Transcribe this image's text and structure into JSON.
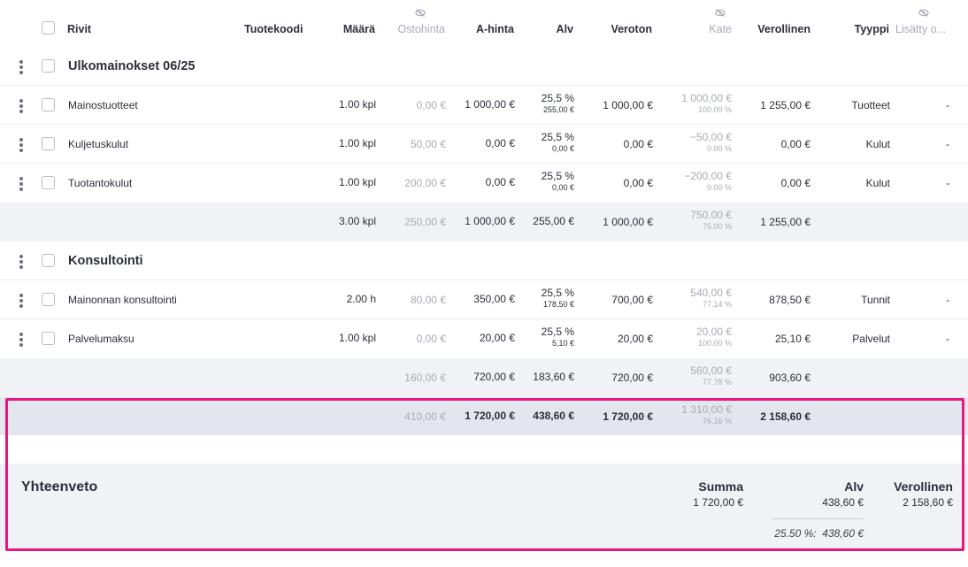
{
  "columns": {
    "rows": "Rivit",
    "product_code": "Tuotekoodi",
    "quantity": "Määrä",
    "purchase_price": "Ostohinta",
    "unit_price": "A-hinta",
    "vat": "Alv",
    "net": "Veroton",
    "margin": "Kate",
    "gross": "Verollinen",
    "type": "Tyyppi",
    "added": "Lisätty o..."
  },
  "groups": [
    {
      "name": "Ulkomainokset 06/25",
      "items": [
        {
          "name": "Mainostuotteet",
          "qty": "1.00 kpl",
          "purchase": "0,00 €",
          "unit": "1 000,00 €",
          "vat_pct": "25,5 %",
          "vat_amt": "255,00 €",
          "net": "1 000,00 €",
          "margin": "1 000,00 €",
          "margin_pct": "100.00 %",
          "gross": "1 255,00 €",
          "type": "Tuotteet",
          "added": "-"
        },
        {
          "name": "Kuljetuskulut",
          "qty": "1.00 kpl",
          "purchase": "50,00 €",
          "unit": "0,00 €",
          "vat_pct": "25,5 %",
          "vat_amt": "0,00 €",
          "net": "0,00 €",
          "margin": "−50,00 €",
          "margin_pct": "0.00 %",
          "gross": "0,00 €",
          "type": "Kulut",
          "added": "-"
        },
        {
          "name": "Tuotantokulut",
          "qty": "1.00 kpl",
          "purchase": "200,00 €",
          "unit": "0,00 €",
          "vat_pct": "25,5 %",
          "vat_amt": "0,00 €",
          "net": "0,00 €",
          "margin": "−200,00 €",
          "margin_pct": "0.00 %",
          "gross": "0,00 €",
          "type": "Kulut",
          "added": "-"
        }
      ],
      "subtotal": {
        "qty": "3.00 kpl",
        "purchase": "250,00 €",
        "unit": "1 000,00 €",
        "vat": "255,00 €",
        "net": "1 000,00 €",
        "margin": "750,00 €",
        "margin_pct": "75.00 %",
        "gross": "1 255,00 €"
      }
    },
    {
      "name": "Konsultointi",
      "items": [
        {
          "name": "Mainonnan konsultointi",
          "qty": "2.00 h",
          "purchase": "80,00 €",
          "unit": "350,00 €",
          "vat_pct": "25,5 %",
          "vat_amt": "178,50 €",
          "net": "700,00 €",
          "margin": "540,00 €",
          "margin_pct": "77.14 %",
          "gross": "878,50 €",
          "type": "Tunnit",
          "added": "-"
        },
        {
          "name": "Palvelumaksu",
          "qty": "1.00 kpl",
          "purchase": "0,00 €",
          "unit": "20,00 €",
          "vat_pct": "25,5 %",
          "vat_amt": "5,10 €",
          "net": "20,00 €",
          "margin": "20,00 €",
          "margin_pct": "100.00 %",
          "gross": "25,10 €",
          "type": "Palvelut",
          "added": "-"
        }
      ],
      "subtotal": {
        "purchase": "160,00 €",
        "unit": "720,00 €",
        "vat": "183,60 €",
        "net": "720,00 €",
        "margin": "560,00 €",
        "margin_pct": "77.78 %",
        "gross": "903,60 €"
      }
    }
  ],
  "grand_total": {
    "purchase": "410,00 €",
    "unit": "1 720,00 €",
    "vat": "438,60 €",
    "net": "1 720,00 €",
    "margin": "1 310,00 €",
    "margin_pct": "76.16 %",
    "gross": "2 158,60 €"
  },
  "summary": {
    "title": "Yhteenveto",
    "sum_label": "Summa",
    "sum_value": "1 720,00 €",
    "vat_label": "Alv",
    "vat_value": "438,60 €",
    "gross_label": "Verollinen",
    "gross_value": "2 158,60 €",
    "vat_breakdown": "25.50 %:  438,60 €"
  },
  "colors": {
    "highlight": "#e6187f",
    "subtotal_bg": "#f1f2f6",
    "total_bg": "#e4e6ee"
  },
  "icons": {
    "hidden_column": "eye-off-icon",
    "row_menu": "kebab-menu-icon"
  }
}
